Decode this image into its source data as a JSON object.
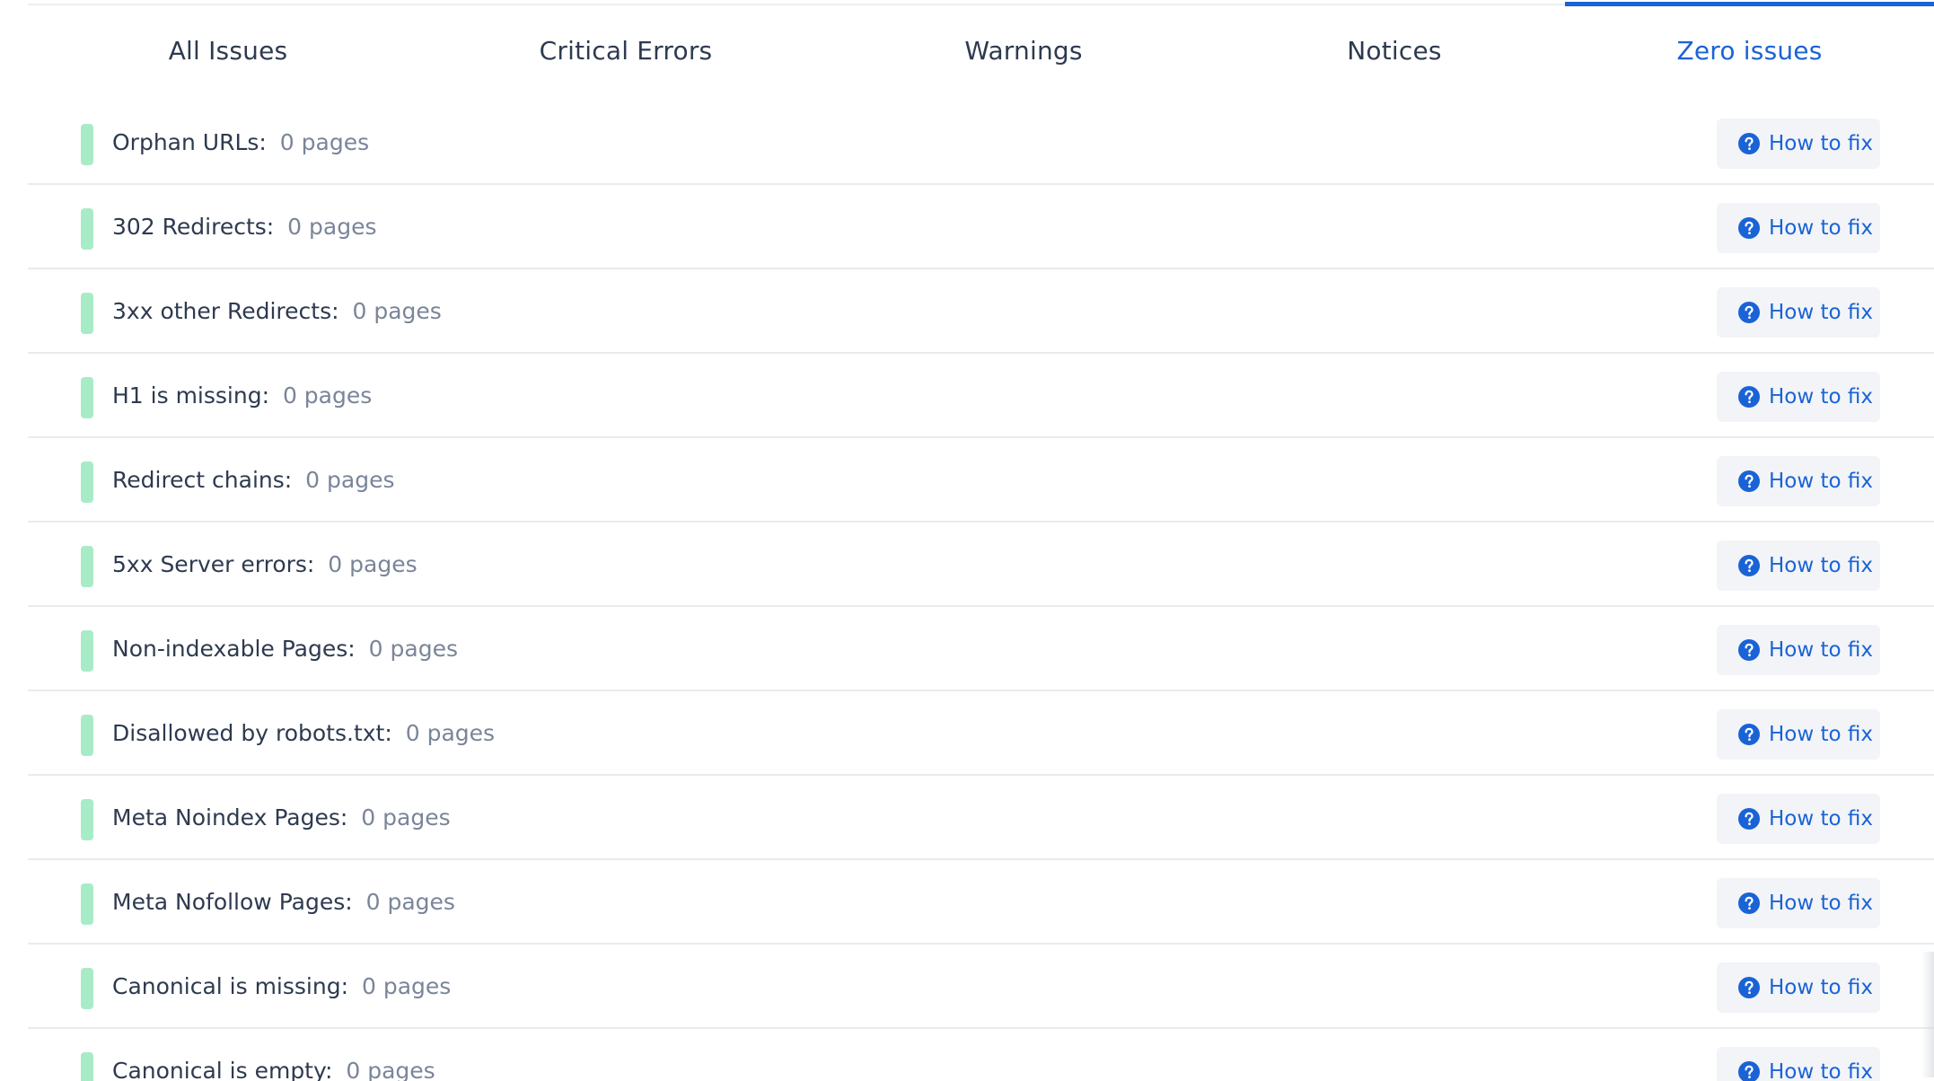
{
  "tabs": [
    {
      "label": "All Issues",
      "active": false
    },
    {
      "label": "Critical Errors",
      "active": false
    },
    {
      "label": "Warnings",
      "active": false
    },
    {
      "label": "Notices",
      "active": false
    },
    {
      "label": "Zero issues",
      "active": true
    }
  ],
  "colors": {
    "accent": "#1a63d6",
    "status_ok": "#a8ecc7",
    "label_text": "#2e3a4f",
    "count_text": "#7a8599"
  },
  "fix_button_label": "How to fix",
  "fix_icon": "question-circle-icon",
  "issues": [
    {
      "label": "Orphan URLs:",
      "count": "0 pages"
    },
    {
      "label": "302 Redirects:",
      "count": "0 pages"
    },
    {
      "label": "3xx other Redirects:",
      "count": "0 pages"
    },
    {
      "label": "H1 is missing:",
      "count": "0 pages"
    },
    {
      "label": "Redirect chains:",
      "count": "0 pages"
    },
    {
      "label": "5xx Server errors:",
      "count": "0 pages"
    },
    {
      "label": "Non-indexable Pages:",
      "count": "0 pages"
    },
    {
      "label": "Disallowed by robots.txt:",
      "count": "0 pages"
    },
    {
      "label": "Meta Noindex Pages:",
      "count": "0 pages"
    },
    {
      "label": "Meta Nofollow Pages:",
      "count": "0 pages"
    },
    {
      "label": "Canonical is missing:",
      "count": "0 pages"
    },
    {
      "label": "Canonical is empty:",
      "count": "0 pages"
    }
  ]
}
